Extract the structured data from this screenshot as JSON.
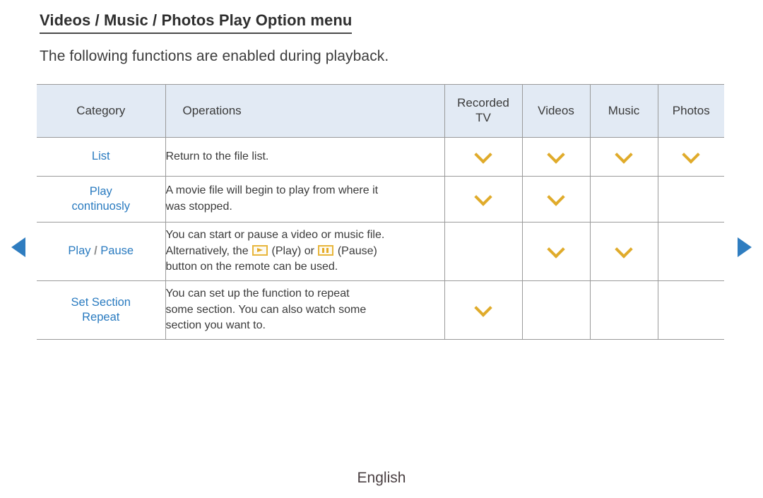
{
  "document": {
    "title": "Videos / Music / Photos Play Option menu",
    "subtitle": "The following functions are enabled during playback.",
    "footer_language": "English"
  },
  "navigation": {
    "prev_icon": "triangle-left-icon",
    "next_icon": "triangle-right-icon"
  },
  "colors": {
    "header_background": "#e2eaf4",
    "category_link": "#2a7bc0",
    "check_mark": "#e0ab2b",
    "key_border": "#e8b63c",
    "nav_arrow": "#2f7dc0",
    "grid_line": "#9a9a9a"
  },
  "table": {
    "columns": [
      {
        "key": "category",
        "label": "Category"
      },
      {
        "key": "operations",
        "label": "Operations"
      },
      {
        "key": "recorded_tv",
        "label": "Recorded\nTV",
        "line1": "Recorded",
        "line2": "TV"
      },
      {
        "key": "videos",
        "label": "Videos"
      },
      {
        "key": "music",
        "label": "Music"
      },
      {
        "key": "photos",
        "label": "Photos"
      }
    ],
    "rows": [
      {
        "category": "List",
        "category_parts": {
          "first": "List",
          "sep": "",
          "second": ""
        },
        "operations": "Return to the file list.",
        "operation_lines": [
          "Return to the file list."
        ],
        "recorded_tv": true,
        "videos": true,
        "music": true,
        "photos": true
      },
      {
        "category": "Play continuosly",
        "category_parts": {
          "first": "Play",
          "sep": "",
          "second": "continuosly"
        },
        "operations": "A movie file will begin to play from where it was stopped.",
        "operation_lines": [
          "A movie file will begin to play from where it",
          "was stopped."
        ],
        "recorded_tv": true,
        "videos": true,
        "music": false,
        "photos": false
      },
      {
        "category": "Play / Pause",
        "category_parts": {
          "first": "Play",
          "sep": "/",
          "second": "Pause"
        },
        "operations": "You can start or pause a video or music file. Alternatively, the (Play) or (Pause) button on the remote can be used.",
        "operation_lines": [
          "You can start or pause a video or music file.",
          "Alternatively, the [play] (Play) or [pause] (Pause)",
          "button on the remote can be used."
        ],
        "inline_keys": [
          {
            "icon": "play-key-icon",
            "label": "(Play)"
          },
          {
            "icon": "pause-key-icon",
            "label": "(Pause)"
          }
        ],
        "line2_prefix": "Alternatively, the ",
        "line2_mid": " (Play) or ",
        "line2_suffix": " (Pause)",
        "recorded_tv": false,
        "videos": true,
        "music": true,
        "photos": false
      },
      {
        "category": "Set Section Repeat",
        "category_parts": {
          "first": "Set Section",
          "sep": "",
          "second": "Repeat"
        },
        "operations": "You can set up the function to repeat some section. You can also watch some section you want to.",
        "operation_lines": [
          "You can set up the function to repeat",
          "some section. You can also watch some",
          "section you want to."
        ],
        "recorded_tv": true,
        "videos": false,
        "music": false,
        "photos": false
      }
    ]
  }
}
